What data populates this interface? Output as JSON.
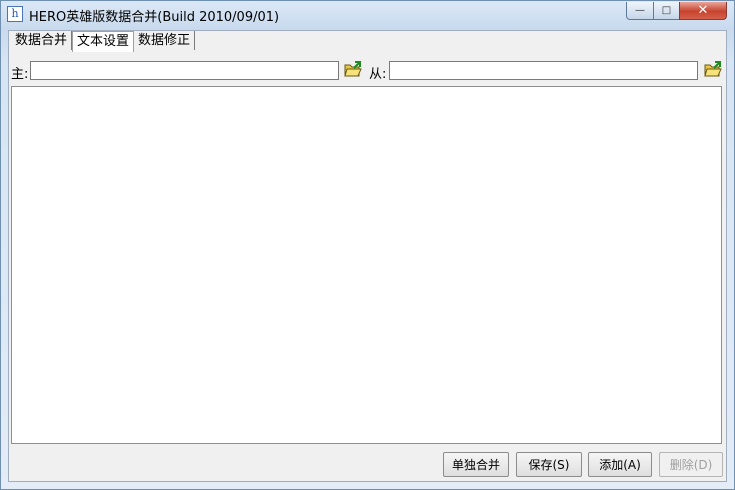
{
  "window": {
    "title": "HERO英雄版数据合并(Build 2010/09/01)",
    "app_icon_glyph": "h",
    "minimize_glyph": "—",
    "maximize_glyph": "□",
    "close_glyph": "✕"
  },
  "tabs": [
    {
      "label": "数据合并",
      "active": false
    },
    {
      "label": "文本设置",
      "active": true
    },
    {
      "label": "数据修正",
      "active": false
    }
  ],
  "fields": {
    "main_label": "主:",
    "main_value": "",
    "secondary_label": "从:",
    "secondary_value": ""
  },
  "buttons": {
    "merge_single": "单独合并",
    "save": "保存(S)",
    "add": "添加(A)",
    "delete": "删除(D)"
  },
  "icons": {
    "browse": "folder-open-icon"
  }
}
